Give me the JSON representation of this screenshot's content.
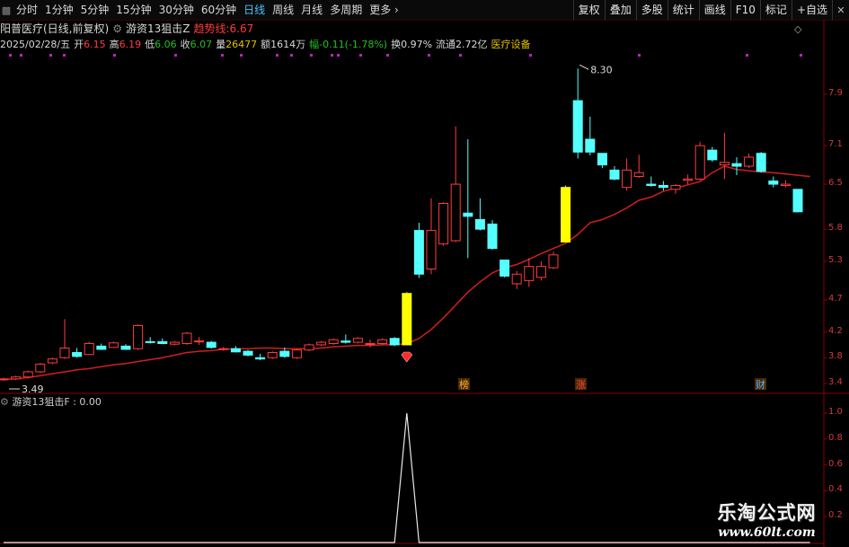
{
  "toolbar": {
    "left_items": [
      "分时",
      "1分钟",
      "5分钟",
      "15分钟",
      "30分钟",
      "60分钟",
      "日线",
      "周线",
      "月线",
      "多周期",
      "更多"
    ],
    "active_index": 6,
    "right_buttons": [
      "复权",
      "叠加",
      "多股",
      "统计",
      "画线",
      "F10",
      "标记",
      "+自选"
    ]
  },
  "info": {
    "stock_name": "阳普医疗(日线,前复权)",
    "indicator_name": "游资13狙击Z",
    "trend_label": "趋势线:",
    "trend_value": "6.67",
    "date": "2025/02/28/五",
    "open_label": "开",
    "open": "6.15",
    "high_label": "高",
    "high": "6.19",
    "low_label": "低",
    "low": "6.06",
    "close_label": "收",
    "close": "6.07",
    "vol_label": "量",
    "vol": "26477",
    "amt_label": "额",
    "amt": "1614万",
    "chg_label": "幅",
    "chg": "-0.11(-1.78%)",
    "turnover_label": "换",
    "turnover": "0.97%",
    "float_label": "流通",
    "float": "2.72亿",
    "sector": "医疗设备"
  },
  "yaxis": [
    "7.9",
    "7.1",
    "6.5",
    "5.8",
    "5.3",
    "4.7",
    "4.2",
    "3.8",
    "3.4"
  ],
  "ind_yaxis": [
    "1.0",
    "0.8",
    "0.6",
    "0.4",
    "0.2"
  ],
  "annotations": {
    "high_mark": "8.30",
    "low_mark": "3.49",
    "badges": [
      "榜",
      "涨",
      "财"
    ]
  },
  "indicator": {
    "name": "游资13狙击F",
    "value": "0.00"
  },
  "watermark": {
    "title": "乐淘公式网",
    "url": "www.60lt.com"
  },
  "colors": {
    "up": "#ff3c3c",
    "down": "#54ffff",
    "signal": "#ffff00",
    "ma": "#d21e1e",
    "axis": "#8a0000"
  },
  "chart_data": {
    "type": "candlestick",
    "ylim": [
      3.3,
      8.5
    ],
    "ma_values": [
      3.46,
      3.47,
      3.49,
      3.52,
      3.55,
      3.58,
      3.61,
      3.63,
      3.66,
      3.69,
      3.71,
      3.74,
      3.77,
      3.8,
      3.84,
      3.88,
      3.9,
      3.91,
      3.93,
      3.94,
      3.94,
      3.95,
      3.95,
      3.94,
      3.94,
      3.94,
      3.95,
      3.97,
      3.98,
      3.99,
      3.99,
      4.0,
      4.0,
      4.02,
      4.1,
      4.24,
      4.42,
      4.62,
      4.82,
      4.98,
      5.12,
      5.2,
      5.25,
      5.33,
      5.42,
      5.5,
      5.58,
      5.72,
      5.9,
      5.95,
      6.03,
      6.13,
      6.25,
      6.3,
      6.39,
      6.44,
      6.49,
      6.54,
      6.68,
      6.78,
      6.73,
      6.71,
      6.69,
      6.68,
      6.66,
      6.64,
      6.62
    ],
    "candles": [
      {
        "o": 3.46,
        "h": 3.49,
        "l": 3.44,
        "c": 3.47
      },
      {
        "o": 3.47,
        "h": 3.52,
        "l": 3.45,
        "c": 3.5
      },
      {
        "o": 3.5,
        "h": 3.6,
        "l": 3.48,
        "c": 3.58
      },
      {
        "o": 3.58,
        "h": 3.72,
        "l": 3.56,
        "c": 3.7
      },
      {
        "o": 3.72,
        "h": 3.8,
        "l": 3.7,
        "c": 3.78
      },
      {
        "o": 3.8,
        "h": 4.4,
        "l": 3.78,
        "c": 3.95
      },
      {
        "o": 3.88,
        "h": 3.95,
        "l": 3.8,
        "c": 3.82
      },
      {
        "o": 3.85,
        "h": 4.05,
        "l": 3.84,
        "c": 4.02
      },
      {
        "o": 3.98,
        "h": 4.02,
        "l": 3.92,
        "c": 3.93
      },
      {
        "o": 3.96,
        "h": 4.05,
        "l": 3.95,
        "c": 4.03
      },
      {
        "o": 3.98,
        "h": 4.01,
        "l": 3.92,
        "c": 3.93
      },
      {
        "o": 3.94,
        "h": 4.32,
        "l": 3.92,
        "c": 4.3
      },
      {
        "o": 4.05,
        "h": 4.12,
        "l": 4.02,
        "c": 4.04
      },
      {
        "o": 4.05,
        "h": 4.1,
        "l": 4.01,
        "c": 4.02
      },
      {
        "o": 4.01,
        "h": 4.06,
        "l": 3.99,
        "c": 4.04
      },
      {
        "o": 4.02,
        "h": 4.2,
        "l": 4.0,
        "c": 4.18
      },
      {
        "o": 4.05,
        "h": 4.12,
        "l": 4.0,
        "c": 4.06
      },
      {
        "o": 4.04,
        "h": 4.06,
        "l": 3.94,
        "c": 3.96
      },
      {
        "o": 3.93,
        "h": 3.97,
        "l": 3.91,
        "c": 3.94
      },
      {
        "o": 3.94,
        "h": 3.98,
        "l": 3.88,
        "c": 3.89
      },
      {
        "o": 3.9,
        "h": 3.92,
        "l": 3.82,
        "c": 3.84
      },
      {
        "o": 3.8,
        "h": 3.86,
        "l": 3.76,
        "c": 3.78
      },
      {
        "o": 3.8,
        "h": 3.9,
        "l": 3.78,
        "c": 3.88
      },
      {
        "o": 3.9,
        "h": 3.96,
        "l": 3.8,
        "c": 3.82
      },
      {
        "o": 3.8,
        "h": 3.94,
        "l": 3.78,
        "c": 3.92
      },
      {
        "o": 3.92,
        "h": 4.02,
        "l": 3.9,
        "c": 4.0
      },
      {
        "o": 4.0,
        "h": 4.06,
        "l": 3.98,
        "c": 4.04
      },
      {
        "o": 4.02,
        "h": 4.1,
        "l": 4.0,
        "c": 4.08
      },
      {
        "o": 4.06,
        "h": 4.16,
        "l": 4.02,
        "c": 4.04
      },
      {
        "o": 4.04,
        "h": 4.12,
        "l": 4.02,
        "c": 4.1
      },
      {
        "o": 4.01,
        "h": 4.08,
        "l": 3.96,
        "c": 4.02
      },
      {
        "o": 4.02,
        "h": 4.1,
        "l": 4.0,
        "c": 4.08
      },
      {
        "o": 4.1,
        "h": 4.12,
        "l": 3.98,
        "c": 4.0
      },
      {
        "o": 4.0,
        "h": 4.82,
        "l": 4.0,
        "c": 4.8,
        "s": 1
      },
      {
        "o": 5.78,
        "h": 5.9,
        "l": 5.04,
        "c": 5.1
      },
      {
        "o": 5.18,
        "h": 6.28,
        "l": 5.1,
        "c": 5.78
      },
      {
        "o": 5.57,
        "h": 6.22,
        "l": 5.54,
        "c": 6.2
      },
      {
        "o": 5.62,
        "h": 7.4,
        "l": 5.6,
        "c": 6.5
      },
      {
        "o": 6.05,
        "h": 7.2,
        "l": 5.35,
        "c": 6.0
      },
      {
        "o": 5.95,
        "h": 6.28,
        "l": 5.78,
        "c": 5.8
      },
      {
        "o": 5.88,
        "h": 5.94,
        "l": 5.48,
        "c": 5.5
      },
      {
        "o": 5.32,
        "h": 5.3,
        "l": 5.05,
        "c": 5.07
      },
      {
        "o": 4.95,
        "h": 5.15,
        "l": 4.87,
        "c": 5.1
      },
      {
        "o": 5.0,
        "h": 5.35,
        "l": 4.9,
        "c": 5.22
      },
      {
        "o": 5.05,
        "h": 5.3,
        "l": 5.0,
        "c": 5.22
      },
      {
        "o": 5.2,
        "h": 5.45,
        "l": 5.18,
        "c": 5.4
      },
      {
        "o": 5.6,
        "h": 6.48,
        "l": 5.6,
        "c": 6.45,
        "s": 1
      },
      {
        "o": 7.8,
        "h": 8.3,
        "l": 6.9,
        "c": 7.0
      },
      {
        "o": 7.2,
        "h": 7.55,
        "l": 6.95,
        "c": 7.0
      },
      {
        "o": 6.98,
        "h": 6.96,
        "l": 6.75,
        "c": 6.8
      },
      {
        "o": 6.72,
        "h": 6.78,
        "l": 6.56,
        "c": 6.58
      },
      {
        "o": 6.45,
        "h": 6.9,
        "l": 6.4,
        "c": 6.72
      },
      {
        "o": 6.62,
        "h": 6.96,
        "l": 6.6,
        "c": 6.68
      },
      {
        "o": 6.5,
        "h": 6.62,
        "l": 6.46,
        "c": 6.48
      },
      {
        "o": 6.48,
        "h": 6.55,
        "l": 6.4,
        "c": 6.45
      },
      {
        "o": 6.42,
        "h": 6.5,
        "l": 6.35,
        "c": 6.48
      },
      {
        "o": 6.56,
        "h": 6.65,
        "l": 6.5,
        "c": 6.58
      },
      {
        "o": 6.58,
        "h": 7.16,
        "l": 6.56,
        "c": 7.1
      },
      {
        "o": 7.03,
        "h": 7.08,
        "l": 6.85,
        "c": 6.88
      },
      {
        "o": 6.8,
        "h": 7.3,
        "l": 6.58,
        "c": 6.84
      },
      {
        "o": 6.82,
        "h": 6.92,
        "l": 6.64,
        "c": 6.78
      },
      {
        "o": 6.78,
        "h": 6.98,
        "l": 6.75,
        "c": 6.92
      },
      {
        "o": 6.98,
        "h": 7.0,
        "l": 6.68,
        "c": 6.7
      },
      {
        "o": 6.55,
        "h": 6.62,
        "l": 6.45,
        "c": 6.5
      },
      {
        "o": 6.48,
        "h": 6.56,
        "l": 6.45,
        "c": 6.5
      },
      {
        "o": 6.42,
        "h": 6.42,
        "l": 6.06,
        "c": 6.07
      }
    ],
    "indicator_values": [
      0,
      0,
      0,
      0,
      0,
      0,
      0,
      0,
      0,
      0,
      0,
      0,
      0,
      0,
      0,
      0,
      0,
      0,
      0,
      0,
      0,
      0,
      0,
      0,
      0,
      0,
      0,
      0,
      0,
      0,
      0,
      0,
      0,
      1,
      0,
      0,
      0,
      0,
      0,
      0,
      0,
      0,
      0,
      0,
      0,
      0,
      0,
      0,
      0,
      0,
      0,
      0,
      0,
      0,
      0,
      0,
      0,
      0,
      0,
      0,
      0,
      0,
      0,
      0,
      0,
      0,
      0
    ]
  }
}
